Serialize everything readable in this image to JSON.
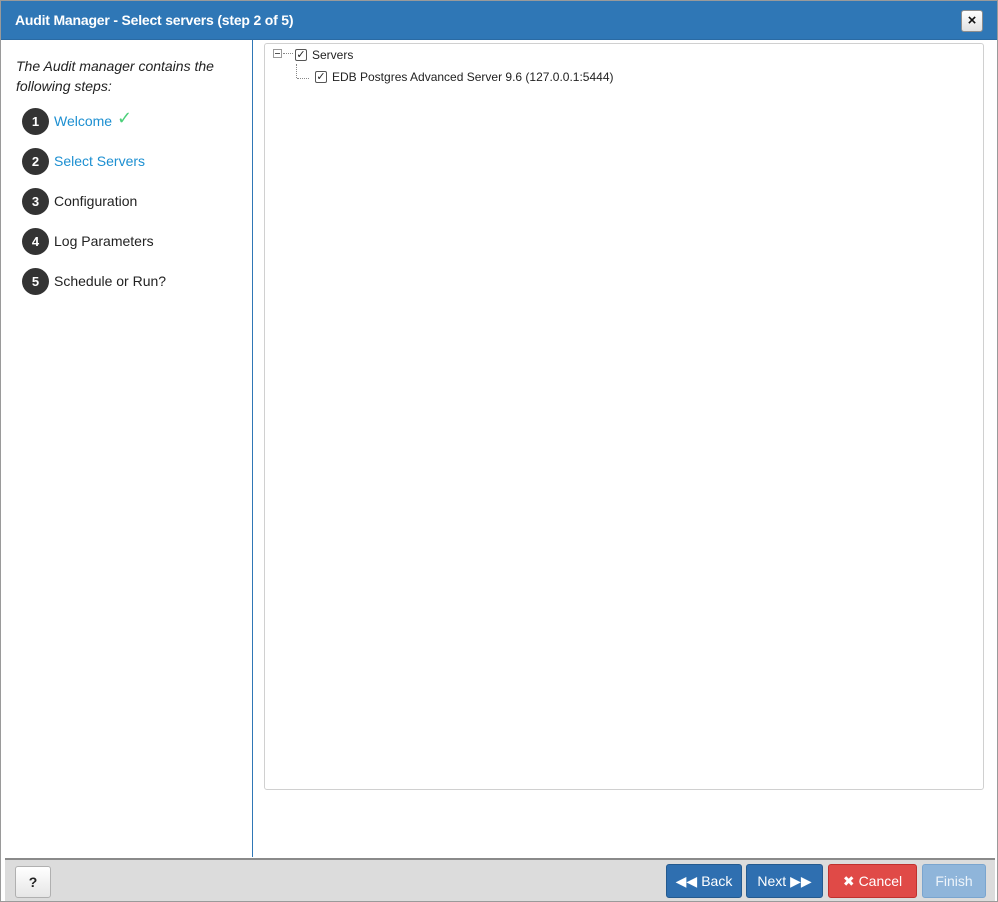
{
  "dialog": {
    "title": "Audit Manager - Select servers (step 2 of 5)",
    "close_label": "×"
  },
  "sidebar": {
    "intro": "The Audit manager contains the following steps:",
    "steps": [
      {
        "number": "1",
        "label": "Welcome",
        "state": "completed",
        "check": "✓"
      },
      {
        "number": "2",
        "label": "Select Servers",
        "state": "current"
      },
      {
        "number": "3",
        "label": "Configuration",
        "state": "pending"
      },
      {
        "number": "4",
        "label": "Log Parameters",
        "state": "pending"
      },
      {
        "number": "5",
        "label": "Schedule or Run?",
        "state": "pending"
      }
    ]
  },
  "tree": {
    "root": {
      "label": "Servers",
      "checked": true,
      "expanded": true
    },
    "children": [
      {
        "label": "EDB Postgres Advanced Server 9.6 (127.0.0.1:5444)",
        "checked": true
      }
    ],
    "check_mark": "✓"
  },
  "footer": {
    "help_label": "?",
    "back_label": "Back",
    "back_icon": "◀◀",
    "next_label": "Next",
    "next_icon": "▶▶",
    "cancel_label": "Cancel",
    "cancel_icon": "✖",
    "finish_label": "Finish"
  },
  "colors": {
    "title_bar": "#2f77b6",
    "active_step": "#1c8fd1",
    "check_green": "#4cd07a",
    "primary_button": "#2f6fb0",
    "cancel_button": "#e04a47",
    "disabled_button": "#8fb5da"
  }
}
